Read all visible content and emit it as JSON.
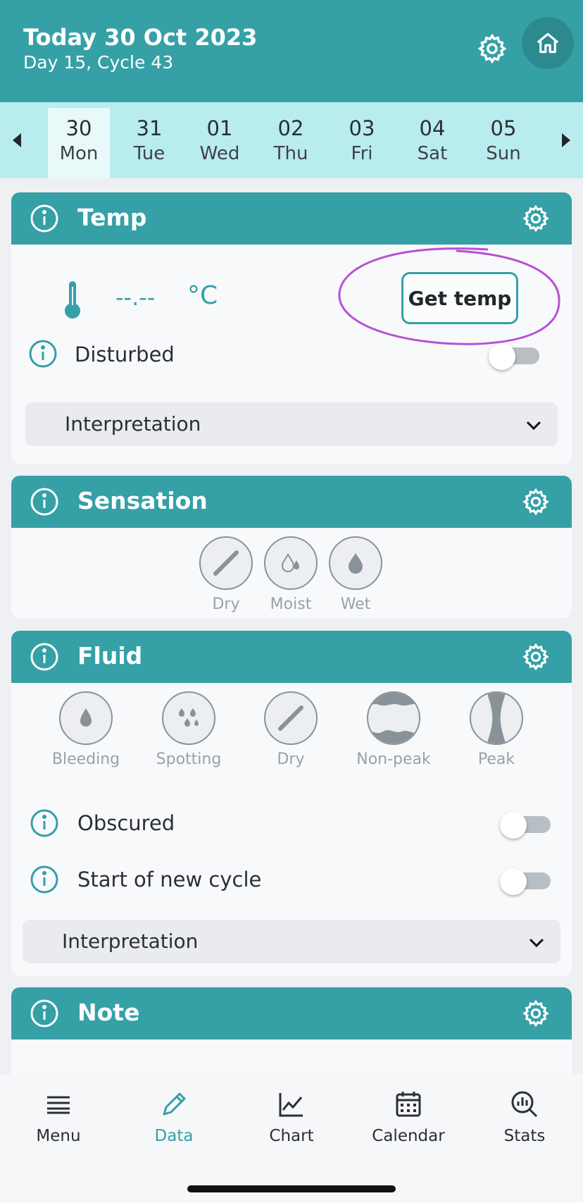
{
  "header": {
    "title": "Today 30 Oct 2023",
    "subtitle": "Day 15, Cycle 43"
  },
  "days": [
    {
      "num": "30",
      "dow": "Mon",
      "selected": true
    },
    {
      "num": "31",
      "dow": "Tue"
    },
    {
      "num": "01",
      "dow": "Wed"
    },
    {
      "num": "02",
      "dow": "Thu"
    },
    {
      "num": "03",
      "dow": "Fri"
    },
    {
      "num": "04",
      "dow": "Sat"
    },
    {
      "num": "05",
      "dow": "Sun"
    }
  ],
  "temp": {
    "title": "Temp",
    "value": "--.--",
    "unit": "°C",
    "get_temp_label": "Get temp",
    "disturbed_label": "Disturbed",
    "disturbed_on": false,
    "interpretation_label": "Interpretation"
  },
  "sensation": {
    "title": "Sensation",
    "options": [
      "Dry",
      "Moist",
      "Wet"
    ]
  },
  "fluid": {
    "title": "Fluid",
    "options": [
      "Bleeding",
      "Spotting",
      "Dry",
      "Non-peak",
      "Peak"
    ],
    "obscured_label": "Obscured",
    "obscured_on": false,
    "new_cycle_label": "Start of new cycle",
    "new_cycle_on": false,
    "interpretation_label": "Interpretation"
  },
  "note": {
    "title": "Note"
  },
  "nav": {
    "items": [
      {
        "label": "Menu",
        "icon": "menu-icon"
      },
      {
        "label": "Data",
        "icon": "pencil-icon",
        "active": true
      },
      {
        "label": "Chart",
        "icon": "chart-icon"
      },
      {
        "label": "Calendar",
        "icon": "calendar-icon"
      },
      {
        "label": "Stats",
        "icon": "stats-icon"
      }
    ]
  },
  "colors": {
    "accent": "#35a0a6",
    "strip": "#b9ecef",
    "annotation": "#b94fd6"
  }
}
